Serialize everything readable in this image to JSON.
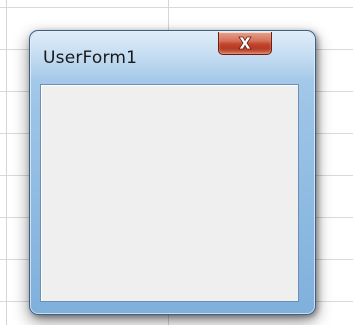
{
  "window": {
    "title": "UserForm1",
    "close_icon": "close-icon"
  },
  "colors": {
    "frame_blue": "#9bc3e6",
    "close_red": "#c2452c",
    "client_bg": "#efefef"
  }
}
